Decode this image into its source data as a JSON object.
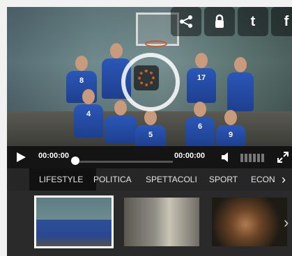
{
  "player": {
    "current_time": "00:00:00",
    "duration": "00:00:00",
    "progress": 0.0,
    "jersey_numbers": [
      "8",
      "17",
      "4",
      "5",
      "6",
      "9"
    ]
  },
  "share": {
    "icons": [
      "share-icon",
      "lock-icon",
      "twitter-icon",
      "facebook-icon"
    ],
    "twitter_glyph": "t",
    "facebook_glyph": "f"
  },
  "nav": {
    "tabs": [
      "LIFESTYLE",
      "POLITICA",
      "SPETTACOLI",
      "SPORT",
      "ECON"
    ],
    "active_tab": "LIFESTYLE"
  },
  "thumbnails": [
    {
      "selected": true
    },
    {
      "selected": false
    },
    {
      "selected": false
    }
  ],
  "colors": {
    "accent_orange": "#d2581e",
    "jersey_blue": "#2b57b8"
  }
}
